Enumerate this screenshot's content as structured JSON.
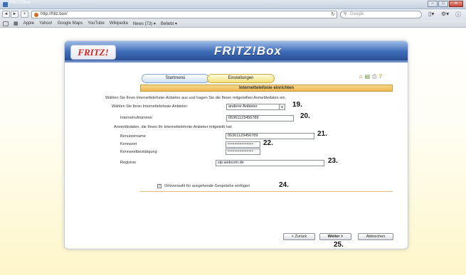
{
  "window": {
    "title": "FRITZ!Box"
  },
  "nav": {
    "url": "http://fritz.box/",
    "search_placeholder": "Google",
    "back": "◄",
    "forward": "►",
    "add": "+"
  },
  "bookmarks": [
    "Apple",
    "Yahoo!",
    "Google Maps",
    "YouTube",
    "Wikipedia",
    "News (73) ▾",
    "Beliebt ▾"
  ],
  "banner": {
    "logo": "FRITZ!",
    "title": "FRITZ!Box"
  },
  "tabs": {
    "start": "Startmenü",
    "settings": "Einstellungen"
  },
  "section_title": "Internettelefonie einrichten",
  "intro": "Wählen Sie Ihren Internettelefonie-Anbieter aus und tragen Sie die Ihnen mitgeteilten Anmeldedaten ein.",
  "provider": {
    "label": "Wählen Sie Ihren Internettelefonie-Anbieter:",
    "value": "anderer Anbieter"
  },
  "phone": {
    "label": "Internetrufnummer",
    "value": "05361123456789"
  },
  "credentials_label": "Anmeldedaten, die Ihnen Ihr Internettelefonie-Anbieter mitgeteilt hat:",
  "username": {
    "label": "Benutzername",
    "value": "05361123456789"
  },
  "password": {
    "label": "Kennwort",
    "value": "•••••••••••••••"
  },
  "password_confirm": {
    "label": "Kennwortbestätigung",
    "value": "•••••••••••••••"
  },
  "registrar": {
    "label": "Registrar",
    "value": "sip.webcom.de"
  },
  "area_code": {
    "label": "Ortsvorwahl für ausgehende Gespräche einfügen",
    "checked": true
  },
  "buttons": {
    "back": "< Zurück",
    "next": "Weiter >",
    "cancel": "Abbrechen"
  },
  "markers": {
    "m19": "19.",
    "m20": "20.",
    "m21": "21.",
    "m22": "22.",
    "m23": "23.",
    "m24": "24.",
    "m25": "25."
  }
}
